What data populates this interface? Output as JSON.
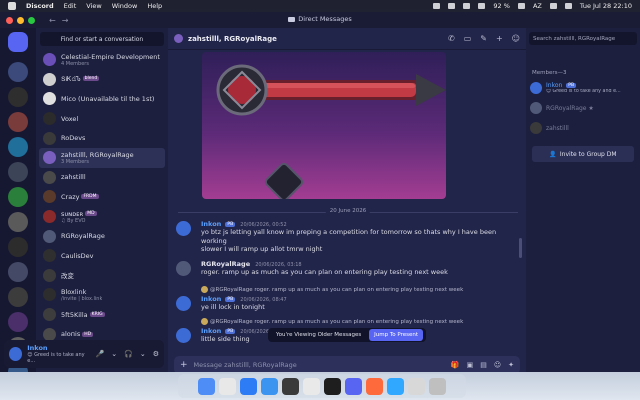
{
  "menubar": {
    "app": "Discord",
    "items": [
      "Edit",
      "View",
      "Window",
      "Help"
    ],
    "battery": "92 %",
    "input": "AZ",
    "datetime": "Tue Jul 28  22:10"
  },
  "window": {
    "title": "Direct Messages"
  },
  "servers": [
    {
      "color": "#5865f2"
    },
    {
      "color": "#3b4a7a"
    },
    {
      "color": "#2e2e2e"
    },
    {
      "color": "#7a3b3b"
    },
    {
      "color": "#1f6f9a"
    },
    {
      "color": "#3c4458"
    },
    {
      "color": "#2a7f3a"
    },
    {
      "color": "#5a5a5a"
    },
    {
      "color": "#2c2c2c"
    },
    {
      "color": "#444a66"
    },
    {
      "color": "#3c3c3c"
    },
    {
      "color": "#4a2f6a"
    },
    {
      "color": "#5f5f5f"
    },
    {
      "color": "#355a8a"
    },
    {
      "color": "#6a4a2a"
    }
  ],
  "dm_sidebar": {
    "search": "Find or start a conversation",
    "items": [
      {
        "name": "Celestial-Empire Development",
        "sub": "4 Members",
        "color": "#6b4fb8"
      },
      {
        "name": "ՏᎥᏦ𝚍Ꮦ",
        "badge": "blend",
        "color": "#cfcfcf"
      },
      {
        "name": "Mico (Unavailable til the 1st)",
        "sub": "",
        "color": "#e0e0e0"
      },
      {
        "name": "Voxel",
        "sub": "",
        "color": "#2b2b2b"
      },
      {
        "name": "RoDevs",
        "sub": "",
        "color": "#3a3a3a"
      },
      {
        "name": "zahstilll, RGRoyalRage",
        "sub": "3 Members",
        "color": "#7b5fbf",
        "active": true
      },
      {
        "name": "zahstilll",
        "sub": "",
        "color": "#4a4a4a"
      },
      {
        "name": "Crazy",
        "badge": "FRDM",
        "color": "#5a3a2a"
      },
      {
        "name": "ꜱᴜɴᴅᴇʀ",
        "badge": "MD",
        "sub": "♫ By EVO",
        "color": "#8a2a2a"
      },
      {
        "name": "RGRoyalRage",
        "sub": "",
        "color": "#505a78"
      },
      {
        "name": "CaulisDev",
        "sub": "",
        "color": "#2f2f2f"
      },
      {
        "name": "改変",
        "sub": "",
        "color": "#3b3b3b"
      },
      {
        "name": "Bloxlink",
        "sub": "/invite | blox.link",
        "color": "#2d2d2d"
      },
      {
        "name": "5ft5Killa",
        "badge": "KRIG",
        "color": "#3d3d3d"
      },
      {
        "name": "aloпis",
        "badge": "HD",
        "color": "#4a4a4a"
      }
    ]
  },
  "user_panel": {
    "name": "Inkon",
    "status": "😊 Greed is to take any e..."
  },
  "chat": {
    "header": "zahstilll, RGRoyalRage",
    "search_placeholder": "Search zahstilll, RGRoyalRage",
    "date_divider": "20 June 2026",
    "messages": [
      {
        "author": "Inkon",
        "tag": "PB",
        "time": "20/06/2026, 00:52",
        "lines": [
          "yo btz js letting yall know im preping a competition for tomorrow so thats why I have been working",
          "slower I will ramp up allot tmrw night"
        ]
      },
      {
        "author": "RGRoyalRage",
        "tag": "",
        "time": "20/06/2026, 03:18",
        "lines": [
          "roger. ramp up as much as you can plan on entering play testing next week"
        ]
      },
      {
        "reply": "@RGRoyalRage roger. ramp up as much as you can plan on entering play testing next week",
        "author": "Inkon",
        "tag": "PB",
        "time": "20/06/2026, 08:47",
        "lines": [
          "ye ill lock in tonight"
        ]
      },
      {
        "reply": "@RGRoyalRage roger. ramp up as much as you can plan on entering play testing next week",
        "author": "Inkon",
        "tag": "PB",
        "time": "20/06/2026, 08:47",
        "lines": [
          "little side thing"
        ]
      }
    ],
    "older_notice": "You're Viewing Older Messages",
    "jump_label": "Jump To Present",
    "composer_placeholder": "Message zahstilll, RGRoyalRage"
  },
  "members": {
    "title": "Members—3",
    "list": [
      {
        "name": "Inkon",
        "tag": "PB",
        "sub": "😊 Greed is to take any and e...",
        "color": "#3d6bd6",
        "name_color": "#5aa0ff"
      },
      {
        "name": "RGRoyalRage",
        "tag": "★",
        "sub": "",
        "color": "#505a78",
        "name_color": "#7a7d98"
      },
      {
        "name": "zahstilll",
        "tag": "",
        "sub": "",
        "color": "#3a3a3a",
        "name_color": "#7a7d98"
      }
    ],
    "invite_label": "Invite to Group DM"
  },
  "dock": {
    "apps": [
      "#4e8df5",
      "#e8e8e8",
      "#2d7cf6",
      "#3a94f0",
      "#3a3a3a",
      "#e9e9e9",
      "#1e1e1e",
      "#5865f2",
      "#ff6a3d",
      "#31a8ff",
      "#d8d8d8",
      "#bfbfbf"
    ]
  }
}
